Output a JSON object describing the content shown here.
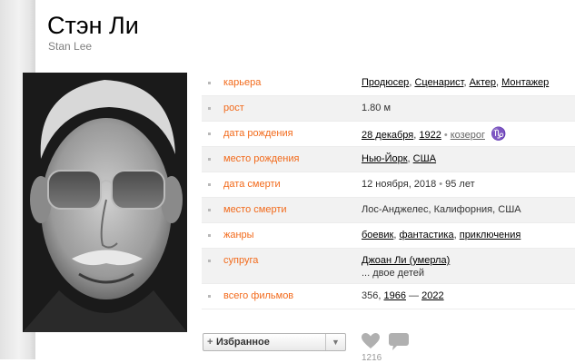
{
  "person": {
    "name_ru": "Стэн Ли",
    "name_en": "Stan Lee"
  },
  "info": {
    "career": {
      "label": "карьера",
      "items": [
        "Продюсер",
        "Сценарист",
        "Актер",
        "Монтажер"
      ]
    },
    "height": {
      "label": "рост",
      "value": "1.80 м"
    },
    "birth_date": {
      "label": "дата рождения",
      "day": "28 декабря",
      "year": "1922",
      "zodiac": "козерог",
      "zodiac_glyph": "♑"
    },
    "birth_place": {
      "label": "место рождения",
      "city": "Нью-Йорк",
      "country": "США"
    },
    "death_date": {
      "label": "дата смерти",
      "value": "12 ноября, 2018",
      "age": "95 лет"
    },
    "death_place": {
      "label": "место смерти",
      "value": "Лос-Анджелес, Калифорния, США"
    },
    "genres": {
      "label": "жанры",
      "items": [
        "боевик",
        "фантастика",
        "приключения"
      ]
    },
    "spouse": {
      "label": "супруга",
      "name": "Джоан Ли (умерла)",
      "children": "... двое детей"
    },
    "films": {
      "label": "всего фильмов",
      "count": "356",
      "year_from": "1966",
      "dash": "—",
      "year_to": "2022"
    }
  },
  "actions": {
    "favorite_plus": "+",
    "favorite_label": "Избранное",
    "likes_count": "1216"
  },
  "icons": {
    "heart": "heart-icon",
    "comment": "comment-icon",
    "dropdown": "chevron-down-icon"
  }
}
